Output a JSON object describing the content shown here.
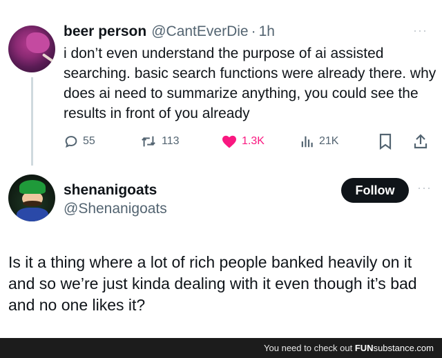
{
  "tweet1": {
    "name": "beer person",
    "handle": "@CantEverDie",
    "separator": "·",
    "time": "1h",
    "more": "···",
    "body": "i don’t even understand the purpose of ai assisted searching.  basic search functions were already there.  why does ai need to summarize anything, you could see the results in front of you already",
    "actions": {
      "replies": "55",
      "reposts": "113",
      "likes": "1.3K",
      "views": "21K"
    },
    "like_color": "#f91880"
  },
  "tweet2": {
    "name": "shenanigoats",
    "handle": "@Shenanigoats",
    "follow_label": "Follow",
    "more": "···",
    "body": "Is it a thing where a lot of rich people banked heavily on it and so we’re just kinda dealing with it even though it’s bad and no one likes it?"
  },
  "footer": {
    "prefix": "You need to check out ",
    "brand_bold": "FUN",
    "brand_rest": "substance.com"
  }
}
